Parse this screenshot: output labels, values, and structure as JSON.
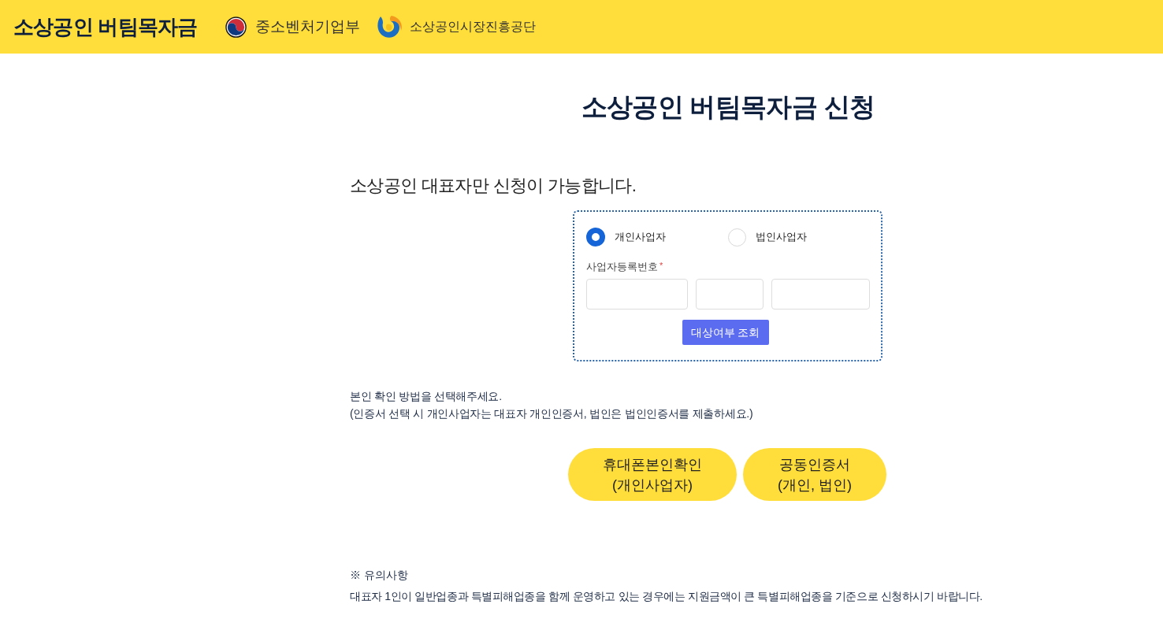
{
  "header": {
    "title": "소상공인 버팀목자금",
    "ministry": "중소벤처기업부",
    "agency": "소상공인시장진흥공단"
  },
  "page_title": "소상공인 버팀목자금 신청",
  "notice": "소상공인 대표자만 신청이 가능합니다.",
  "lookup_form": {
    "business_types": [
      {
        "label": "개인사업자",
        "selected": true
      },
      {
        "label": "법인사업자",
        "selected": false
      }
    ],
    "field_label": "사업자등록번호",
    "required_mark": "*",
    "button": "대상여부 조회"
  },
  "verification": {
    "instructions": [
      "본인 확인 방법을 선택해주세요.",
      "(인증서 선택 시 개인사업자는 대표자 개인인증서, 법인은 법인인증서를 제출하세요.)"
    ],
    "methods": [
      {
        "label": "휴대폰본인확인\n(개인사업자)"
      },
      {
        "label": "공동인증서\n(개인, 법인)"
      }
    ]
  },
  "caution": {
    "heading": "※ 유의사항",
    "text": "대표자 1인이 일반업종과 특별피해업종을 함께 운영하고 있는 경우에는 지원금액이 큰 특별피해업종을 기준으로 신청하시기 바랍니다."
  }
}
